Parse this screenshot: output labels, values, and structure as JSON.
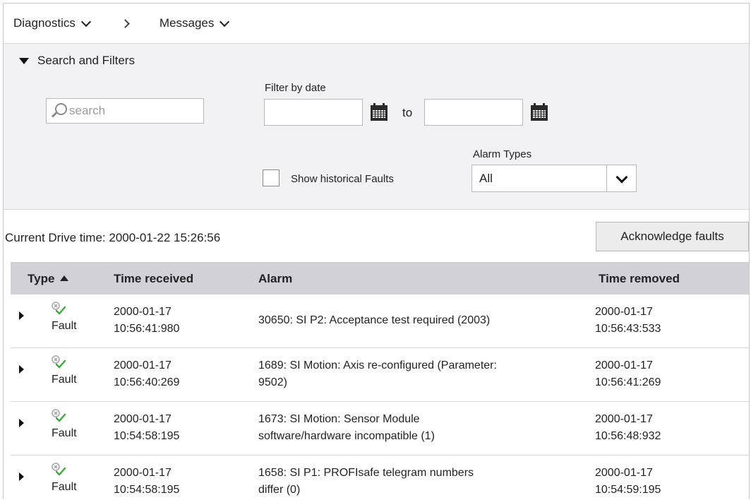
{
  "breadcrumb": {
    "diagnostics": "Diagnostics",
    "messages": "Messages"
  },
  "filters": {
    "toggle_label": "Search and Filters",
    "search_placeholder": "search",
    "filter_by_date_label": "Filter by date",
    "date_from": "",
    "date_to": "",
    "to_label": "to",
    "show_historical_label": "Show historical Faults",
    "show_historical_checked": false,
    "alarm_types_label": "Alarm Types",
    "alarm_types_value": "All"
  },
  "status": {
    "drive_time": "Current Drive time: 2000-01-22 15:26:56"
  },
  "actions": {
    "acknowledge_label": "Acknowledge faults"
  },
  "table": {
    "columns": {
      "type": "Type",
      "time_received": "Time received",
      "alarm": "Alarm",
      "time_removed": "Time removed"
    },
    "sort": {
      "column": "type",
      "direction": "ascending"
    },
    "rows": [
      {
        "type": "Fault",
        "recv_date": "2000-01-17",
        "recv_time": "10:56:41:980",
        "alarm_line1": "30650: SI P2: Acceptance test required (2003)",
        "alarm_line2": "",
        "rem_date": "2000-01-17",
        "rem_time": "10:56:43:533"
      },
      {
        "type": "Fault",
        "recv_date": "2000-01-17",
        "recv_time": "10:56:40:269",
        "alarm_line1": "1689: SI Motion: Axis re-configured (Parameter:",
        "alarm_line2": "9502)",
        "rem_date": "2000-01-17",
        "rem_time": "10:56:41:269"
      },
      {
        "type": "Fault",
        "recv_date": "2000-01-17",
        "recv_time": "10:54:58:195",
        "alarm_line1": "1673: SI Motion: Sensor Module",
        "alarm_line2": "software/hardware incompatible (1)",
        "rem_date": "2000-01-17",
        "rem_time": "10:56:48:932"
      },
      {
        "type": "Fault",
        "recv_date": "2000-01-17",
        "recv_time": "10:54:58:195",
        "alarm_line1": "1658: SI P1: PROFIsafe telegram numbers",
        "alarm_line2": "differ (0)",
        "rem_date": "2000-01-17",
        "rem_time": "10:54:59:195"
      }
    ]
  },
  "icons": {
    "fault_x_color": "#a8a8a8",
    "fault_check_color": "#3caa3c",
    "filter_panel_bg": "#f2f2f4",
    "table_header_bg": "#d1d1d6"
  }
}
